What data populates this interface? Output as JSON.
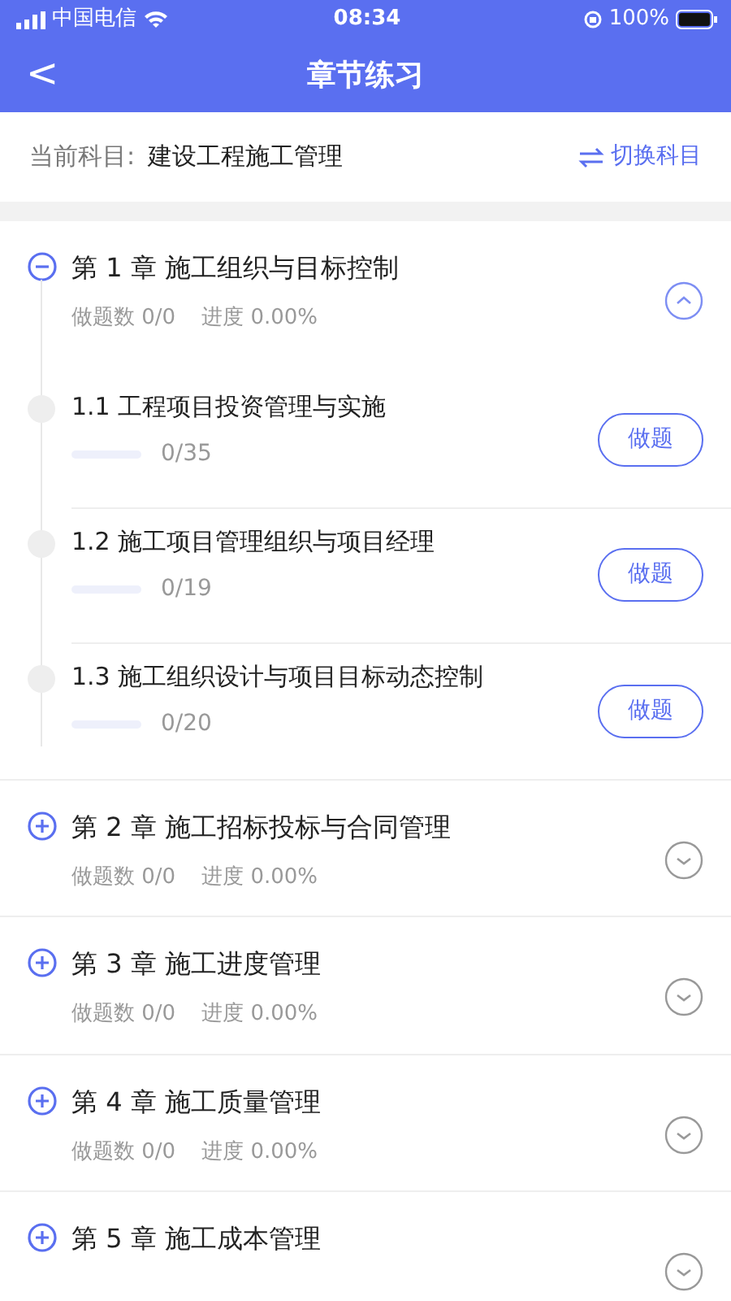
{
  "status_bar": {
    "carrier": "中国电信",
    "time": "08:34",
    "battery": "100%"
  },
  "nav": {
    "back": "<",
    "title": "章节练习"
  },
  "subject": {
    "label": "当前科目:",
    "value": "建设工程施工管理",
    "switch": "切换科目"
  },
  "chapters": [
    {
      "title": "第 1 章 施工组织与目标控制",
      "count": "做题数 0/0",
      "progress": "进度 0.00%",
      "expanded": true,
      "sections": [
        {
          "title": "1.1 工程项目投资管理与实施",
          "level": 0,
          "reading": "0/35",
          "button": "做题"
        },
        {
          "title": "1.2 施工项目管理组织与项目经理",
          "level": 0,
          "reading": "0/19",
          "button": "做题"
        },
        {
          "title": "1.3 施工组织设计与项目目标动态控制",
          "level": 0,
          "reading": "0/20",
          "button": "做题"
        }
      ]
    },
    {
      "title": "第 2 章 施工招标投标与合同管理",
      "count": "做题数 0/0",
      "progress": "进度 0.00%",
      "expanded": false
    },
    {
      "title": "第 3 章 施工进度管理",
      "count": "做题数 0/0",
      "progress": "进度 0.00%",
      "expanded": false
    },
    {
      "title": "第 4 章 施工质量管理",
      "count": "做题数 0/0",
      "progress": "进度 0.00%",
      "expanded": false
    },
    {
      "title": "第 5 章 施工成本管理",
      "expanded": false
    }
  ]
}
